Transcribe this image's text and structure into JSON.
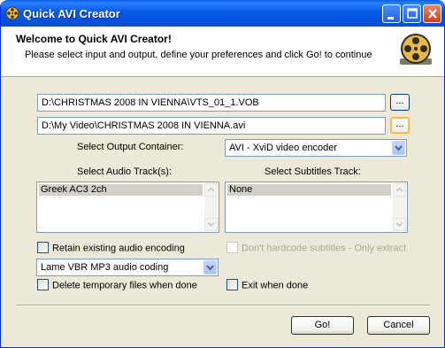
{
  "window": {
    "title": "Quick AVI Creator"
  },
  "header": {
    "title": "Welcome to Quick AVI Creator!",
    "subtitle": "Please select input and output, define your preferences and click Go! to continue"
  },
  "input_path": "D:\\CHRISTMAS 2008 IN VIENNA\\VTS_01_1.VOB",
  "output_path": "D:\\My Video\\CHRISTMAS 2008 IN VIENNA.avi",
  "browse_label": "...",
  "output_container": {
    "label": "Select Output Container:",
    "value": "AVI - XviD video encoder"
  },
  "audio_tracks": {
    "label": "Select Audio Track(s):",
    "items": [
      "Greek AC3 2ch"
    ]
  },
  "subtitles_track": {
    "label": "Select Subtitles Track:",
    "items": [
      "None"
    ]
  },
  "retain_audio": {
    "label": "Retain existing audio encoding",
    "checked": false
  },
  "dont_hardcode": {
    "label": "Don't hardcode subtitles - Only extract",
    "checked": false,
    "disabled": true
  },
  "audio_coding": {
    "value": "Lame VBR MP3 audio coding"
  },
  "delete_temp": {
    "label": "Delete temporary files when done",
    "checked": false
  },
  "exit_when_done": {
    "label": "Exit when done",
    "checked": false
  },
  "buttons": {
    "go": "Go!",
    "cancel": "Cancel"
  }
}
